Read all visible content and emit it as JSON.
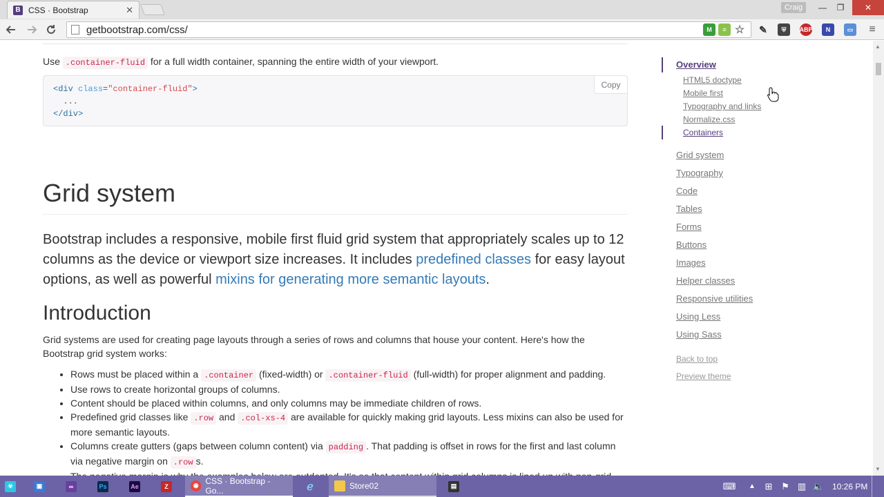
{
  "browser": {
    "tab_title": "CSS · Bootstrap",
    "tab_favicon": "B",
    "user_name": "Craig",
    "url": "getbootstrap.com/css/"
  },
  "content": {
    "fluid_text_pre": "Use ",
    "fluid_code": ".container-fluid",
    "fluid_text_post": " for a full width container, spanning the entire width of your viewport.",
    "code_line1_open": "<div ",
    "code_line1_attr": "class",
    "code_line1_eq": "=",
    "code_line1_str": "\"container-fluid\"",
    "code_line1_close": ">",
    "code_line2": "  ...",
    "code_line3": "</div>",
    "copy_label": "Copy",
    "heading": "Grid system",
    "lead_pre": "Bootstrap includes a responsive, mobile first fluid grid system that appropriately scales up to 12 columns as the device or viewport size increases. It includes ",
    "lead_link1": "predefined classes",
    "lead_mid": " for easy layout options, as well as powerful ",
    "lead_link2": "mixins for generating more semantic layouts",
    "lead_end": ".",
    "subheading": "Introduction",
    "intro": "Grid systems are used for creating page layouts through a series of rows and columns that house your content. Here's how the Bootstrap grid system works:",
    "b1_a": "Rows must be placed within a ",
    "b1_code1": ".container",
    "b1_b": " (fixed-width) or ",
    "b1_code2": ".container-fluid",
    "b1_c": " (full-width) for proper alignment and padding.",
    "b2": "Use rows to create horizontal groups of columns.",
    "b3": "Content should be placed within columns, and only columns may be immediate children of rows.",
    "b4_a": "Predefined grid classes like ",
    "b4_code1": ".row",
    "b4_b": " and ",
    "b4_code2": ".col-xs-4",
    "b4_c": " are available for quickly making grid layouts. Less mixins can also be used for more semantic layouts.",
    "b5_a": "Columns create gutters (gaps between column content) via ",
    "b5_code1": "padding",
    "b5_b": ". That padding is offset in rows for the first and last column via negative margin on ",
    "b5_code2": ".row",
    "b5_c": "s.",
    "b6": "The negative margin is why the examples below are outdented. It's so that content within grid columns is lined up with non-grid"
  },
  "sidenav": {
    "overview": "Overview",
    "sub": [
      "HTML5 doctype",
      "Mobile first",
      "Typography and links",
      "Normalize.css",
      "Containers"
    ],
    "items": [
      "Grid system",
      "Typography",
      "Code",
      "Tables",
      "Forms",
      "Buttons",
      "Images",
      "Helper classes",
      "Responsive utilities",
      "Using Less",
      "Using Sass"
    ],
    "back_to_top": "Back to top",
    "preview_theme": "Preview theme"
  },
  "taskbar": {
    "chrome_task": "CSS · Bootstrap - Go...",
    "folder_task": "Store02",
    "clock": "10:26 PM"
  },
  "colors": {
    "bootstrap_purple": "#563d7c",
    "link_blue": "#337ab7",
    "code_pink": "#c7254e",
    "taskbar": "#6b63a6",
    "close_red": "#c7443c"
  }
}
